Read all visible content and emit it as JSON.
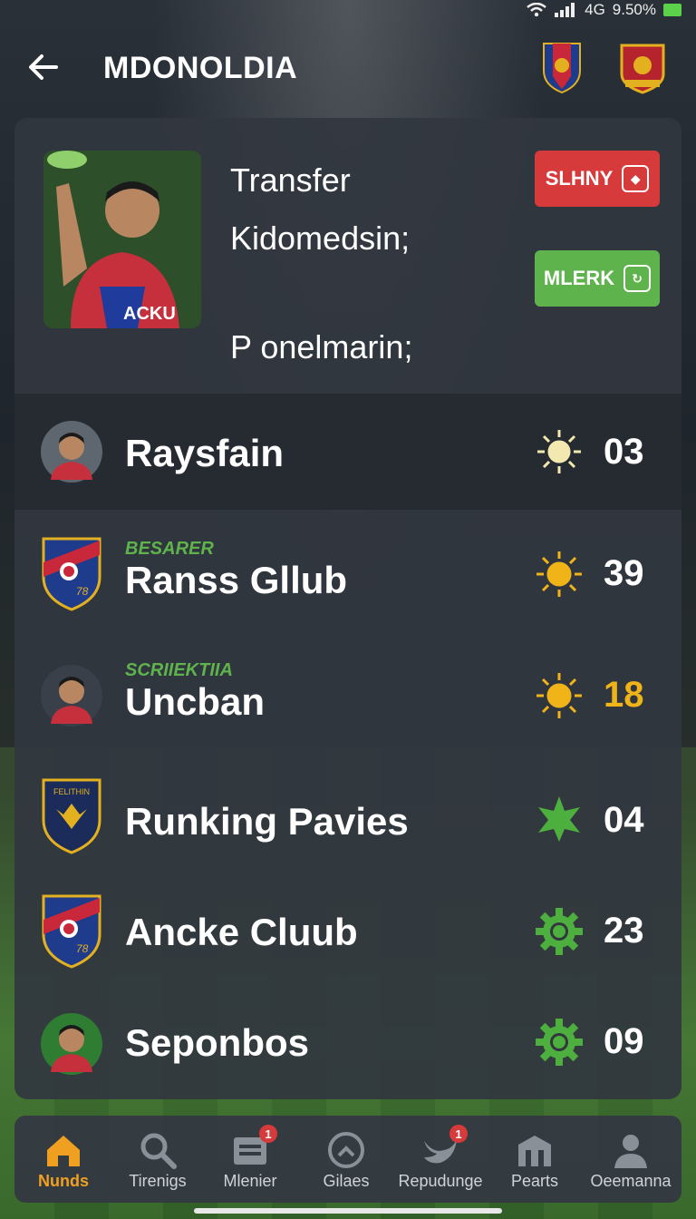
{
  "status_bar": {
    "network": "4G",
    "battery": "9.50%"
  },
  "header": {
    "title": "MDONOLDIA"
  },
  "hero": {
    "line1": "Transfer",
    "line2": "Kidomedsin;",
    "line3": "P onelmarin;",
    "photo_text": "ACKU",
    "tag_red": "SLHNY",
    "tag_green": "MLERK"
  },
  "rows": [
    {
      "name": "Raysfain",
      "sublabel": "",
      "value": "03",
      "status_color": "#f3e9b0"
    },
    {
      "name": "Ranss Gllub",
      "sublabel": "BESARER",
      "value": "39",
      "status_color": "#f0b419"
    },
    {
      "name": "Uncban",
      "sublabel": "SCRIIEKTIIA",
      "value": "18",
      "status_color": "#f0b419"
    },
    {
      "name": "Runking Pavies",
      "sublabel": "",
      "value": "04",
      "status_color": "#4caf3e"
    },
    {
      "name": "Ancke Cluub",
      "sublabel": "",
      "value": "23",
      "status_color": "#4caf3e"
    },
    {
      "name": "Seponbos",
      "sublabel": "",
      "value": "09",
      "status_color": "#4caf3e"
    }
  ],
  "crest_texts": {
    "crest1": "78",
    "crest2": "FELITHIN",
    "crest3": "78"
  },
  "nav": [
    {
      "label": "Nunds",
      "active": true
    },
    {
      "label": "Tirenigs",
      "active": false
    },
    {
      "label": "Mlenier",
      "active": false,
      "badge": "1"
    },
    {
      "label": "Gilaes",
      "active": false
    },
    {
      "label": "Repudunge",
      "active": false,
      "badge": "1"
    },
    {
      "label": "Pearts",
      "active": false
    },
    {
      "label": "Oeemanna",
      "active": false
    }
  ]
}
